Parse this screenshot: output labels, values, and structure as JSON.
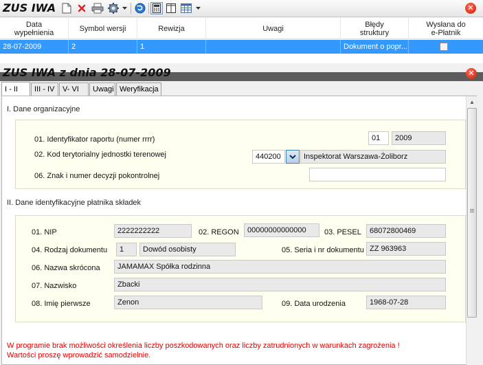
{
  "app": {
    "title": "ZUS IWA"
  },
  "toolbar": {
    "icons": [
      "new-document-icon",
      "delete-icon",
      "print-icon",
      "settings-icon",
      "refresh-icon",
      "calculator-icon",
      "columns-icon",
      "grid-view-icon"
    ],
    "close_color": "#d42a10"
  },
  "grid": {
    "columns": [
      "Data\nwypełnienia",
      "Symbol wersji",
      "Rewizja",
      "Uwagi",
      "Błędy\nstruktury",
      "Wysłana do\ne-Płatnik"
    ],
    "rows": [
      {
        "date": "28-07-2009",
        "symbol": "2",
        "revision": "1",
        "notes": "",
        "errors": "Dokument o popr...",
        "sent": false
      }
    ],
    "selected_color": "#3399ff"
  },
  "form": {
    "title": "ZUS IWA z dnia 28-07-2009",
    "tabs": [
      "I - II",
      "III - IV",
      "V- VI",
      "Uwagi",
      "Weryfikacja"
    ],
    "active_tab": "I - II"
  },
  "section1": {
    "title": "I. Dane organizacyjne",
    "report_id_label": "01. Identyfikator raportu (numer rrrr)",
    "report_id_num": "01",
    "report_id_year": "2009",
    "territory_label": "02. Kod terytorialny jednostki terenowej",
    "territory_code": "440200",
    "territory_name": "Inspektorat Warszawa-Żoliborz",
    "decision_label": "06. Znak i numer decyzji pokontrolnej",
    "decision_value": ""
  },
  "section2": {
    "title": "II. Dane identyfikacyjne płatnika składek",
    "nip_label": "01. NIP",
    "nip": "2222222222",
    "regon_label": "02. REGON",
    "regon": "00000000000000",
    "pesel_label": "03. PESEL",
    "pesel": "68072800469",
    "doc_type_label": "04. Rodzaj dokumentu",
    "doc_type_code": "1",
    "doc_type_name": "Dowód osobisty",
    "doc_number_label": "05. Seria i nr dokumentu",
    "doc_number": "ZZ 963963",
    "short_name_label": "06. Nazwa skrócona",
    "short_name": "JAMAMAX Spółka rodzinna",
    "surname_label": "07. Nazwisko",
    "surname": "Zbacki",
    "first_name_label": "08. Imię pierwsze",
    "first_name": "Zenon",
    "birth_date_label": "09. Data urodzenia",
    "birth_date": "1968-07-28"
  },
  "warning": {
    "line1": "W programie brak możliwości określenia liczby poszkodowanych oraz liczby zatrudnionych w warunkach zagrożenia !",
    "line2": "Wartości proszę wprowadzić samodzielnie."
  }
}
